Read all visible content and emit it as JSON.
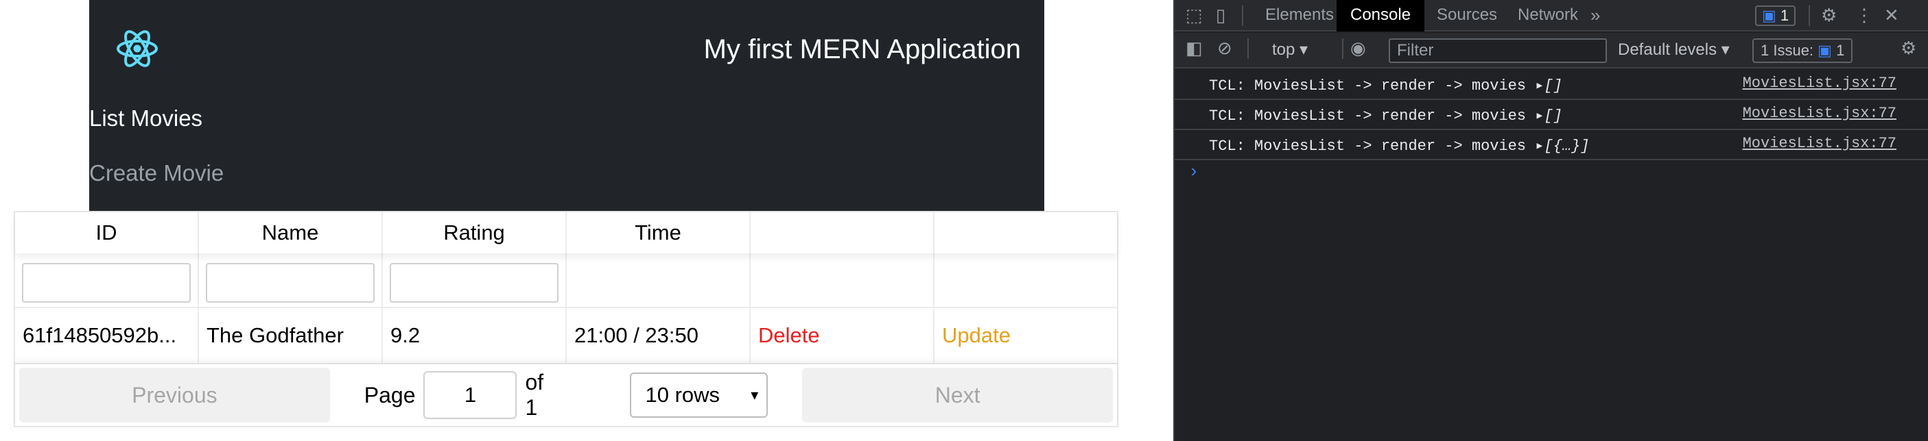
{
  "app": {
    "brand_title": "My first MERN Application",
    "nav": {
      "list_movies": "List Movies",
      "create_movie": "Create Movie"
    },
    "table": {
      "headers": [
        "ID",
        "Name",
        "Rating",
        "Time",
        "",
        ""
      ],
      "rows": [
        {
          "id": "61f14850592b...",
          "name": "The Godfather",
          "rating": "9.2",
          "time": "21:00 / 23:50",
          "delete": "Delete",
          "update": "Update"
        }
      ]
    },
    "pagination": {
      "previous": "Previous",
      "page_label": "Page",
      "page_value": "1",
      "of_label": "of 1",
      "rows_select": "10 rows",
      "next": "Next"
    },
    "colors": {
      "navbar": "#212529",
      "delete": "#e51f1f",
      "update": "#e5a11b",
      "logo": "#61dafb"
    }
  },
  "devtools": {
    "tabs": [
      "Elements",
      "Console",
      "Sources",
      "Network"
    ],
    "active_tab": "Console",
    "more_tabs": "»",
    "message_count": "1",
    "context": "top",
    "filter_placeholder": "Filter",
    "levels": "Default levels",
    "issues_label": "1 Issue:",
    "issues_count": "1",
    "logs": [
      {
        "text": "TCL: MoviesList -> render -> movies ",
        "value": "[]",
        "source": "MoviesList.jsx:77"
      },
      {
        "text": "TCL: MoviesList -> render -> movies ",
        "value": "[]",
        "source": "MoviesList.jsx:77"
      },
      {
        "text": "TCL: MoviesList -> render -> movies ",
        "value": "[{…}]",
        "source": "MoviesList.jsx:77"
      }
    ],
    "prompt_symbol": "›"
  }
}
